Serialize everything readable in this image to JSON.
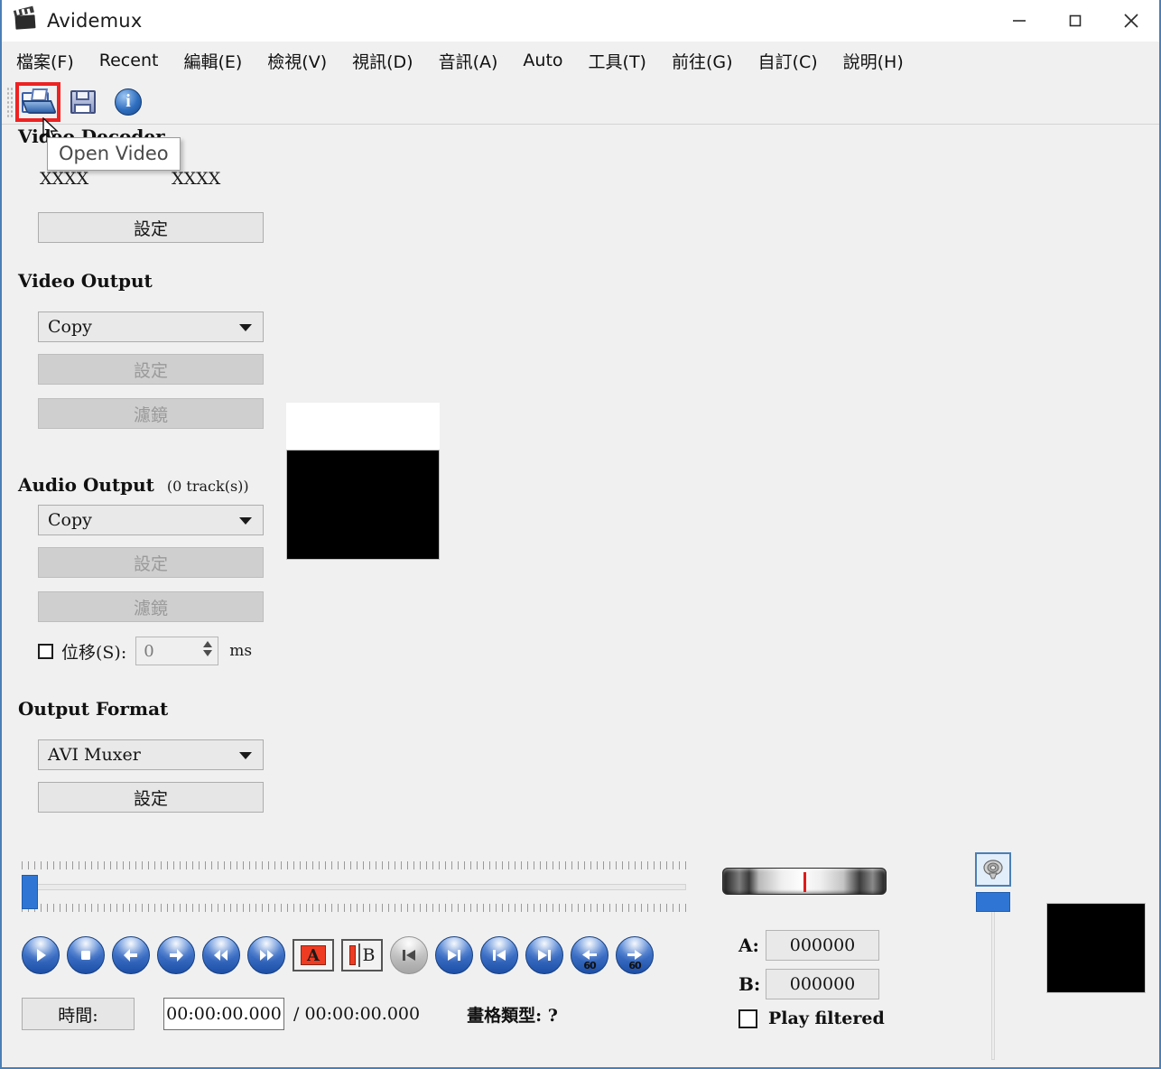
{
  "window": {
    "title": "Avidemux",
    "app_icon": "clapperboard-icon",
    "minimize_label": "−",
    "maximize_label": "□",
    "close_label": "✕"
  },
  "menubar": {
    "items": [
      {
        "label": "檔案(F)",
        "name": "menu-file"
      },
      {
        "label": "Recent",
        "name": "menu-recent"
      },
      {
        "label": "編輯(E)",
        "name": "menu-edit"
      },
      {
        "label": "檢視(V)",
        "name": "menu-view"
      },
      {
        "label": "視訊(D)",
        "name": "menu-video"
      },
      {
        "label": "音訊(A)",
        "name": "menu-audio"
      },
      {
        "label": "Auto",
        "name": "menu-auto"
      },
      {
        "label": "工具(T)",
        "name": "menu-tools"
      },
      {
        "label": "前往(G)",
        "name": "menu-go"
      },
      {
        "label": "自訂(C)",
        "name": "menu-custom"
      },
      {
        "label": "說明(H)",
        "name": "menu-help"
      }
    ]
  },
  "toolbar": {
    "open_icon": "open-folder-icon",
    "save_icon": "save-floppy-icon",
    "info_icon": "info-icon",
    "info_glyph": "i",
    "highlight_color": "#ee2222"
  },
  "tooltip": {
    "text": "Open Video"
  },
  "left_panel": {
    "video_decoder_title": "Video Decoder",
    "codec_left": "XXXX",
    "codec_right": "XXXX",
    "decoder_config_label": "設定",
    "video_output_title": "Video Output",
    "video_output_value": "Copy",
    "video_config_label": "設定",
    "video_filter_label": "濾鏡",
    "audio_output_title": "Audio Output",
    "audio_tracks": "(0 track(s))",
    "audio_output_value": "Copy",
    "audio_config_label": "設定",
    "audio_filter_label": "濾鏡",
    "shift_label": "位移(S):",
    "shift_value": "0",
    "shift_unit": "ms",
    "output_format_title": "Output Format",
    "output_format_value": "AVI Muxer",
    "output_config_label": "設定"
  },
  "playback": {
    "buttons": [
      {
        "name": "play-button",
        "icon": "play-icon"
      },
      {
        "name": "stop-button",
        "icon": "stop-icon"
      },
      {
        "name": "previous-frame-button",
        "icon": "arrow-left-icon"
      },
      {
        "name": "next-frame-button",
        "icon": "arrow-right-icon"
      },
      {
        "name": "rewind-button",
        "icon": "double-arrow-left-icon"
      },
      {
        "name": "forward-button",
        "icon": "double-arrow-right-icon"
      },
      {
        "name": "mark-a-button",
        "icon": "mark-a-icon",
        "label": "A"
      },
      {
        "name": "mark-b-button",
        "icon": "mark-b-icon",
        "label": "B"
      },
      {
        "name": "previous-keyframe-button",
        "icon": "prev-intra-icon"
      },
      {
        "name": "next-keyframe-button",
        "icon": "next-intra-icon"
      },
      {
        "name": "start-button",
        "icon": "skip-start-icon"
      },
      {
        "name": "end-button",
        "icon": "skip-end-icon"
      },
      {
        "name": "back-60-button",
        "icon": "back-60-icon",
        "label": "60"
      },
      {
        "name": "forward-60-button",
        "icon": "forward-60-icon",
        "label": "60"
      }
    ]
  },
  "statusbar": {
    "time_button_label": "時間:",
    "current_time": "00:00:00.000",
    "total_time": "/ 00:00:00.000",
    "frame_type_label": "畫格類型: ?"
  },
  "markers": {
    "a_label": "A:",
    "a_value": "000000",
    "b_label": "B:",
    "b_value": "000000",
    "play_filtered_label": "Play filtered",
    "play_filtered_checked": false
  },
  "volume": {
    "speaker_icon": "speaker-icon",
    "accent_color": "#2f76d4"
  },
  "timeline": {
    "position": 0
  }
}
